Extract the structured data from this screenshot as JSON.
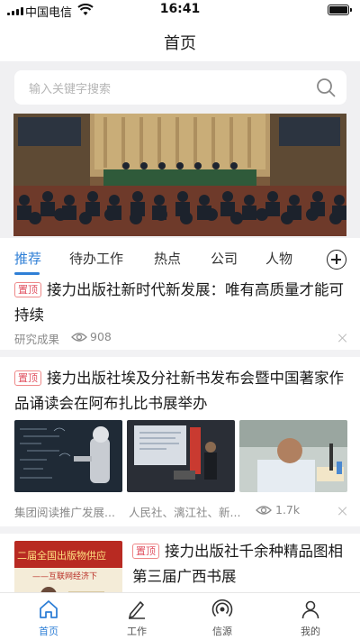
{
  "status_bar": {
    "carrier": "中国电信",
    "time": "16:41"
  },
  "nav": {
    "title": "首页"
  },
  "search": {
    "placeholder": "输入关键字搜索"
  },
  "tabs": [
    "推荐",
    "待办工作",
    "热点",
    "公司",
    "人物"
  ],
  "active_tab": "推荐",
  "feed": [
    {
      "tag": "置顶",
      "title": "接力出版社新时代新发展：唯有高质量才能可持续",
      "source": "研究成果",
      "views": "908"
    },
    {
      "tag": "置顶",
      "title": "接力出版社埃及分社新书发布会暨中国著家作品诵读会在阿布扎比书展举办",
      "sources": [
        "集团阅读推广发展...",
        "人民社、漓江社、新..."
      ],
      "views": "1.7k"
    },
    {
      "tag": "置顶",
      "title": "接力出版社千余种精品图相第三届广西书展",
      "thumb_text": [
        "二届全国出版物供应",
        "——互联网经济下"
      ]
    }
  ],
  "tab_bar": [
    {
      "label": "首页",
      "icon": "home-icon",
      "active": true
    },
    {
      "label": "工作",
      "icon": "pen-icon",
      "active": false
    },
    {
      "label": "信源",
      "icon": "broadcast-icon",
      "active": false
    },
    {
      "label": "我的",
      "icon": "person-icon",
      "active": false
    }
  ],
  "colors": {
    "accent": "#2f7fd6",
    "pin_tag": "#e05060",
    "band_bg": "#f0f0f2"
  }
}
